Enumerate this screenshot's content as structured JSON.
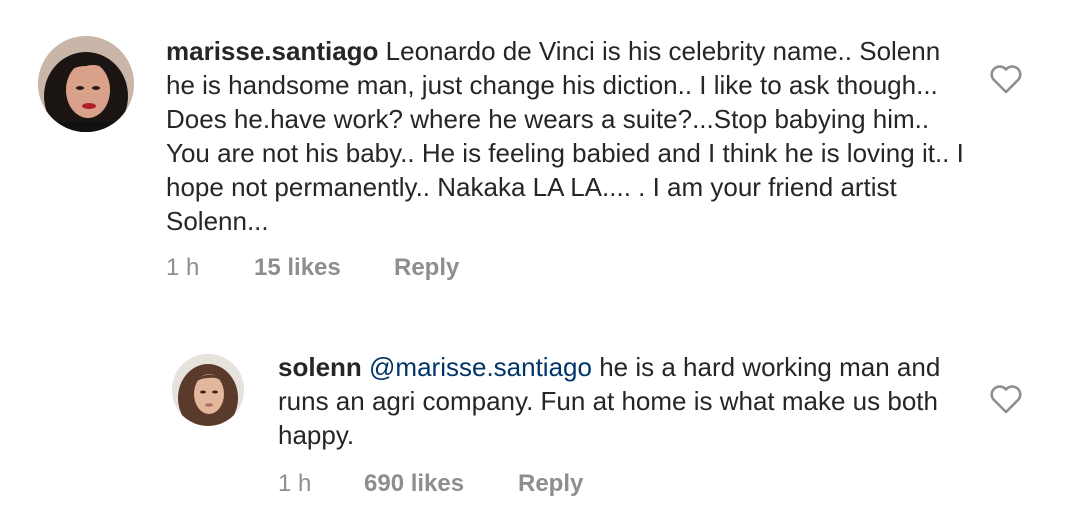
{
  "comments": [
    {
      "username": "marisse.santiago",
      "text": "Leonardo de Vinci is his celebrity name.. Solenn he is handsome man, just change his diction.. I like to ask though... Does he.have work?  where he wears a suite?...Stop babying him.. You are not his baby.. He is feeling babied and I think he is loving it.. I hope not permanently.. Nakaka LA LA.... . I am your friend artist Solenn...",
      "time": "1 h",
      "likes": "15 likes",
      "reply_label": "Reply",
      "icon": "heart-outline-icon"
    },
    {
      "username": "solenn",
      "mention": "@marisse.santiago",
      "text": "he is a hard working man and runs an agri company. Fun at home is what make us both happy.",
      "time": "1 h",
      "likes": "690 likes",
      "reply_label": "Reply",
      "icon": "heart-outline-icon"
    }
  ],
  "colors": {
    "text": "#262626",
    "muted": "#8e8e8e",
    "mention": "#003569"
  }
}
